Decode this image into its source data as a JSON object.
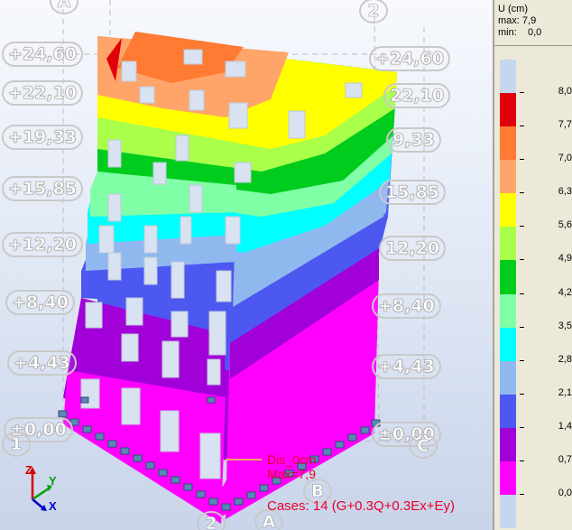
{
  "viewport": {
    "levels_left": [
      "+24,60",
      "+22,10",
      "+19,33",
      "+15,85",
      "+12,20",
      "+8,40",
      "+4,43",
      "±0,00"
    ],
    "levels_right": [
      "+24,60",
      "22,10",
      "9,33",
      "15,85",
      "12,20",
      "+8,40",
      "+4,43",
      "±0,00"
    ],
    "axis_labels": {
      "a_top": "A",
      "two_top": "2",
      "one_left": "1",
      "c_right": "C",
      "b_bottom": "B",
      "two_bottom": "2",
      "a_bottom": "A"
    },
    "annotation": {
      "dis": "Dis_0cm",
      "max": "Max=7,9"
    },
    "cases": "Cases: 14 (G+0.3Q+0.3Ex+Ey)",
    "triad": {
      "z": "Z",
      "y": "Y",
      "x": "X"
    }
  },
  "legend": {
    "title": "U (cm)",
    "max": "max: 7,9",
    "min": "min:    0,0",
    "values": [
      "8,0",
      "7,7",
      "7,0",
      "6,3",
      "5,6",
      "4,9",
      "4,2",
      "3,5",
      "2,8",
      "2,1",
      "1,4",
      "0,7",
      "0,0"
    ],
    "colors": [
      "#c4d7ee",
      "#e0000c",
      "#ff7a32",
      "#ffa56a",
      "#ffff00",
      "#a9ff4a",
      "#00cc1e",
      "#80ffa6",
      "#00ffff",
      "#8fb8ef",
      "#4c58f0",
      "#a100d9",
      "#ff00ff",
      "#c4d7ee"
    ]
  }
}
